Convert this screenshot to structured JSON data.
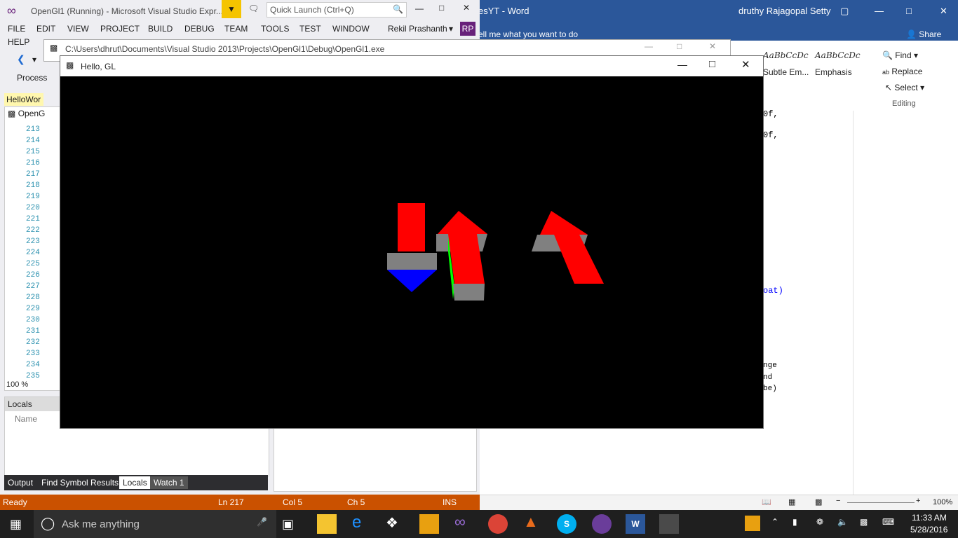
{
  "word": {
    "title": "esYT - Word",
    "user": "druthy Rajagopal Setty",
    "tell_me": "ell me what you want to do",
    "share": "Share",
    "styles": [
      {
        "sample": "AaBbCcDc",
        "name": "Subtle Em..."
      },
      {
        "sample": "AaBbCcDc",
        "name": "Emphasis"
      }
    ],
    "editing": {
      "find": "Find",
      "replace": "Replace",
      "select": "Select",
      "group": "Editing"
    },
    "doc_lines": [
      "0f,",
      "0f,",
      "oat)",
      "nge",
      "nd",
      "be)"
    ],
    "zoom": "100%"
  },
  "vs": {
    "title": "OpenGl1 (Running) - Microsoft Visual Studio Expr...",
    "quick_launch": "Quick Launch (Ctrl+Q)",
    "user": "Rekil Prashanth",
    "user_initials": "RP",
    "menu": [
      "FILE",
      "EDIT",
      "VIEW",
      "PROJECT",
      "BUILD",
      "DEBUG",
      "TEAM",
      "TOOLS",
      "TEST",
      "WINDOW"
    ],
    "help": "HELP",
    "process": "Process",
    "doc_tab": "HelloWor",
    "scope": "OpenG",
    "line_numbers": [
      "213",
      "214",
      "215",
      "216",
      "217",
      "218",
      "219",
      "220",
      "221",
      "222",
      "223",
      "224",
      "225",
      "226",
      "227",
      "228",
      "229",
      "230",
      "231",
      "232",
      "233",
      "234",
      "235"
    ],
    "zoom": "100 %",
    "locals_title": "Locals",
    "locals_col": "Name",
    "bottom_tabs": [
      "Output",
      "Find Symbol Results",
      "Locals",
      "Watch 1"
    ],
    "status": {
      "ready": "Ready",
      "ln": "Ln 217",
      "col": "Col 5",
      "ch": "Ch 5",
      "ins": "INS"
    }
  },
  "console": {
    "path": "C:\\Users\\dhrut\\Documents\\Visual Studio 2013\\Projects\\OpenGl1\\Debug\\OpenGl1.exe"
  },
  "gl": {
    "title": "Hello, GL"
  },
  "taskbar": {
    "search": "Ask me anything",
    "time": "11:33 AM",
    "date": "5/28/2016"
  },
  "colors": {
    "red": "#ff0000",
    "gray": "#808080",
    "blue": "#0000ff",
    "green": "#00ff00",
    "vs_status": "#ca5100",
    "word_blue": "#2b579a"
  }
}
